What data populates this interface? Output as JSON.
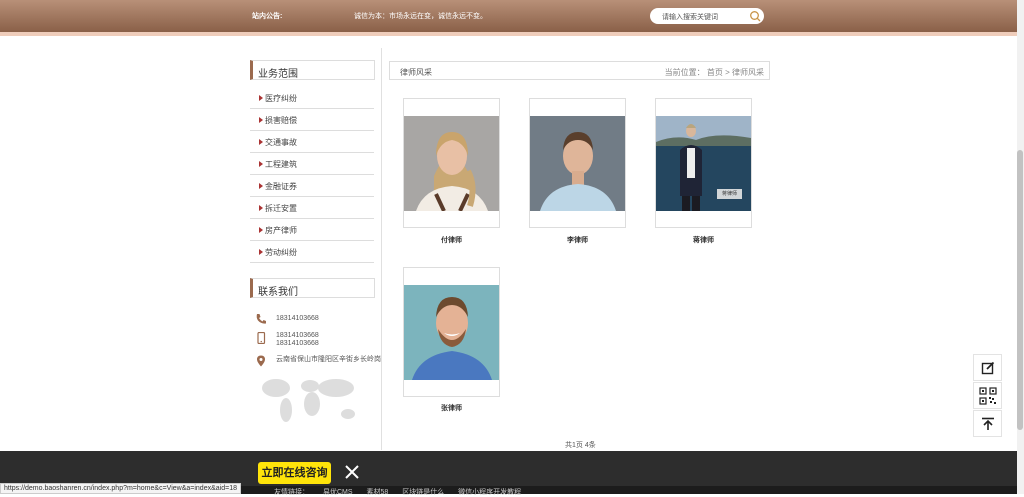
{
  "header": {
    "notice_label": "站内公告:",
    "notice_text": "诚信为本：市场永远在变，诚信永远不变。",
    "search_placeholder": "请输入搜索关键词"
  },
  "sidebar": {
    "business_title": "业务范围",
    "items": [
      {
        "label": "医疗纠纷"
      },
      {
        "label": "损害赔偿"
      },
      {
        "label": "交通事故"
      },
      {
        "label": "工程建筑"
      },
      {
        "label": "金融证券"
      },
      {
        "label": "拆迁安置"
      },
      {
        "label": "房产律师"
      },
      {
        "label": "劳动纠纷"
      }
    ],
    "contact_title": "联系我们",
    "phone": "18314103668",
    "mobile_line1": "18314103668",
    "mobile_line2": "18314103668",
    "address": "云南省保山市隆阳区辛街乡长岭岗"
  },
  "content": {
    "title": "律师风采",
    "breadcrumb_prefix": "当前位置：",
    "breadcrumb_home": "首页",
    "breadcrumb_sep": ">",
    "breadcrumb_current": "律师风采",
    "lawyers": [
      {
        "name": "付律师"
      },
      {
        "name": "李律师"
      },
      {
        "name": "蒋律师",
        "photo_tag": "蒋律师"
      },
      {
        "name": "张律师"
      }
    ],
    "pagination": "共1页 4条"
  },
  "bottom": {
    "consult_label": "立即在线咨询",
    "footer_links": [
      "友情链接：",
      "易优CMS",
      "素材58",
      "区块链是什么",
      "微信小程序开发教程"
    ],
    "status_url": "https://demo.baoshanren.cn/index.php?m=home&c=View&a=index&aid=18"
  },
  "colors": {
    "header_brown": "#9b6a4e",
    "accent_line": "#efcdbb",
    "consult_yellow": "#ffe40a"
  }
}
